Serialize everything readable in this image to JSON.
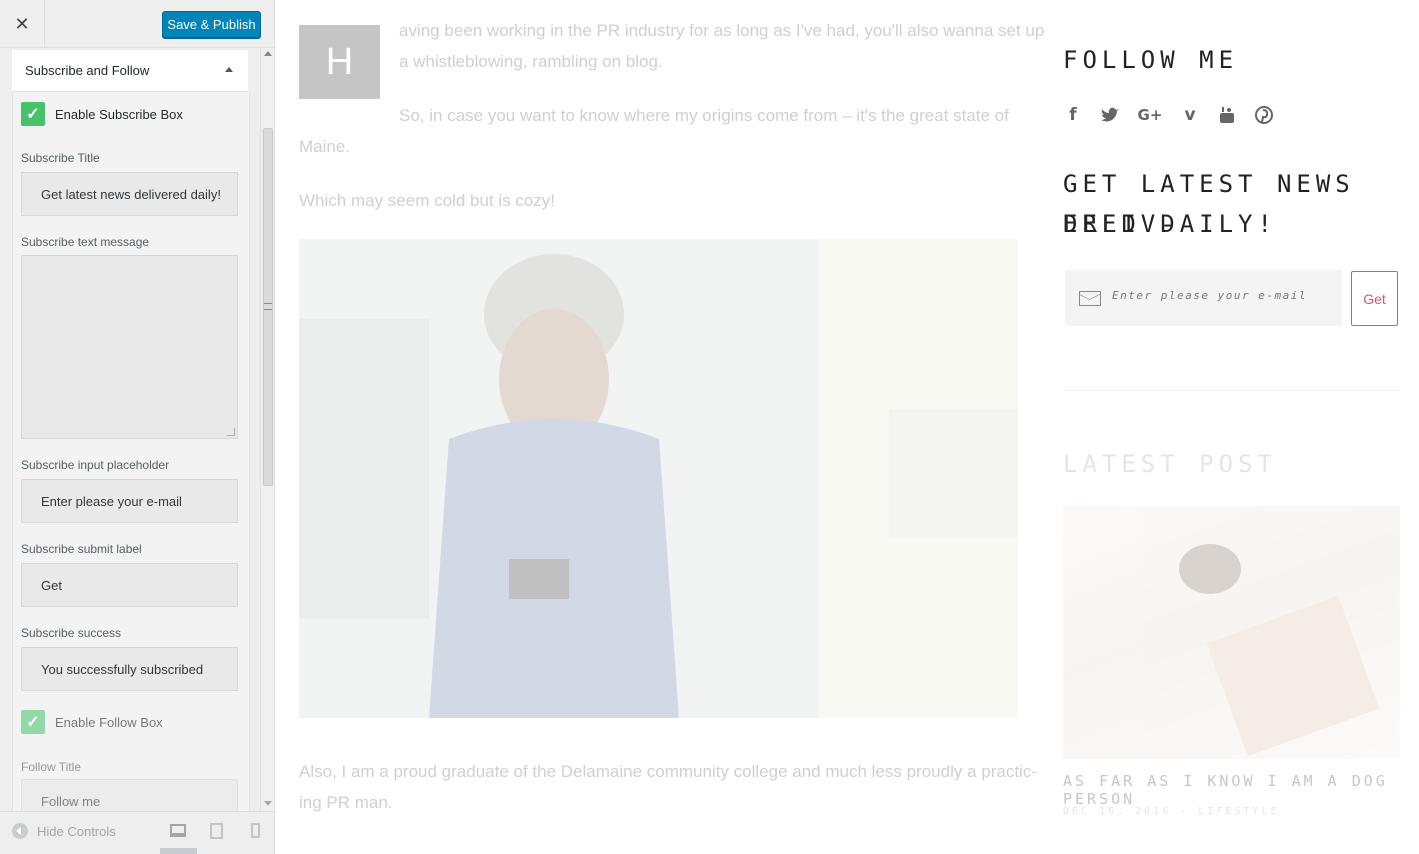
{
  "header": {
    "close_label": "✕",
    "publish_label": "Save & Publish"
  },
  "section": {
    "title": "Subscribe and Follow"
  },
  "fields": {
    "enable_subscribe_label": "Enable Subscribe Box",
    "subscribe_title_label": "Subscribe Title",
    "subscribe_title_value": "Get latest news delivered daily!",
    "subscribe_text_label": "Subscribe text message",
    "subscribe_text_value": "",
    "placeholder_label": "Subscribe input placeholder",
    "placeholder_value": "Enter please your e-mail",
    "submit_label_label": "Subscribe submit label",
    "submit_label_value": "Get",
    "success_label": "Subscribe success",
    "success_value": "You successfully subscribed",
    "enable_follow_label": "Enable Follow Box",
    "follow_title_label": "Follow Title",
    "follow_title_value": "Follow me"
  },
  "footer": {
    "hide_controls_label": "Hide Controls"
  },
  "preview": {
    "dropcap": "H",
    "para1_line1": "aving been working in the PR industry for as long as I've had, you'll also wanna set up",
    "para1_line2": "a whistleblowing, rambling on blog.",
    "para2_line1": "So, in case you want to know where my origins come from – it's the great state of",
    "para2_line2": "Maine.",
    "para3": "Which may seem cold but is cozy!",
    "para4_line1": "Also, I am a proud graduate of the Delamaine community college and much less proudly a practic-",
    "para4_line2": "ing PR man.",
    "follow_title": "FOLLOW ME",
    "social_icons": [
      "facebook-icon",
      "twitter-icon",
      "google-plus-icon",
      "vimeo-icon",
      "youtube-icon",
      "pinterest-icon"
    ],
    "news_title_line1": "GET LATEST NEWS DELIV-",
    "news_title_line2": "ERED DAILY!",
    "email_placeholder": "Enter please your e-mail",
    "get_label": "Get",
    "latest_post_title": "LATEST POST",
    "post_title": "AS FAR AS I KNOW I AM A DOG PERSON",
    "post_meta": "DEC 16, 2016 · LIFESTYLE"
  },
  "colors": {
    "primary_button": "#0085ba",
    "checkbox": "#47c26b",
    "accent": "#e25565"
  }
}
